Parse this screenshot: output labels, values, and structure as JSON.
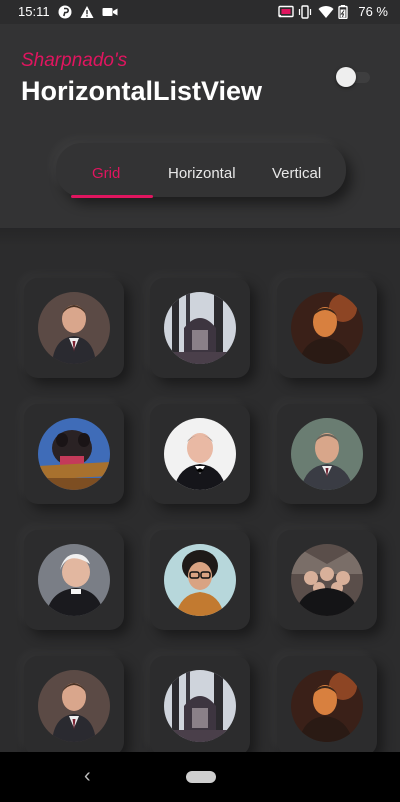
{
  "status_bar": {
    "time": "15:11",
    "battery": "76 %",
    "left_icons": [
      "pinterest-icon",
      "warning-icon",
      "video-camera-icon"
    ],
    "right_icons": [
      "cast-icon",
      "vibrate-icon",
      "wifi-icon",
      "battery-icon"
    ]
  },
  "header": {
    "subtitle": "Sharpnado's",
    "title": "HorizontalListView",
    "dark_mode_toggle": {
      "on": false
    }
  },
  "tabs": [
    {
      "label": "Grid",
      "selected": true
    },
    {
      "label": "Horizontal",
      "selected": false
    },
    {
      "label": "Vertical",
      "selected": false
    }
  ],
  "grid": {
    "avatars": [
      {
        "subject": "man-in-suit-portrait"
      },
      {
        "subject": "dark-forest-scene"
      },
      {
        "subject": "man-orange-light"
      },
      {
        "subject": "puppet-character"
      },
      {
        "subject": "bald-man-bowtie"
      },
      {
        "subject": "grey-haired-man-suit"
      },
      {
        "subject": "priest-white-hair"
      },
      {
        "subject": "man-curly-hair-glasses"
      },
      {
        "subject": "group-of-men-suits"
      },
      {
        "subject": "man-in-suit-portrait"
      },
      {
        "subject": "dark-forest-scene"
      },
      {
        "subject": "man-orange-light"
      }
    ]
  },
  "navigation": {
    "back_icon": "back-chevron-icon",
    "home_icon": "home-pill-icon"
  },
  "colors": {
    "accent": "#e0155f",
    "background": "#2c2c2d",
    "header": "#333334",
    "text": "#ffffff",
    "nav_bar": "#000000"
  }
}
